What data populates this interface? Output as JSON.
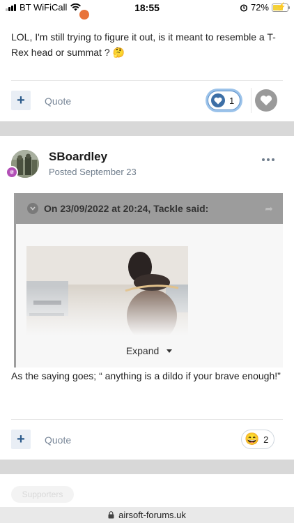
{
  "status_bar": {
    "carrier": "BT WiFiCall",
    "time": "18:55",
    "battery": "72%",
    "battery_level": 0.72
  },
  "post1": {
    "text": "LOL, I'm still trying to figure it out, is it meant to resemble a T-Rex head or summat ? 🤔",
    "quote_label": "Quote",
    "reaction_count": "1"
  },
  "post2": {
    "author": "SBoardley",
    "posted": "Posted September 23",
    "quote": {
      "citation": "On 23/09/2022 at 20:24, Tackle said:",
      "expand_label": "Expand"
    },
    "text": "As the saying goes; “ anything is a dildo if your brave enough!”",
    "quote_label": "Quote",
    "reaction_emoji": "😄",
    "reaction_count": "2"
  },
  "footer": {
    "supporters_label": "Supporters",
    "url": "airsoft-forums.uk"
  },
  "colors": {
    "accent": "#3d6fa6",
    "badge": "#b24fb6",
    "gap": "#d8d8d8"
  }
}
